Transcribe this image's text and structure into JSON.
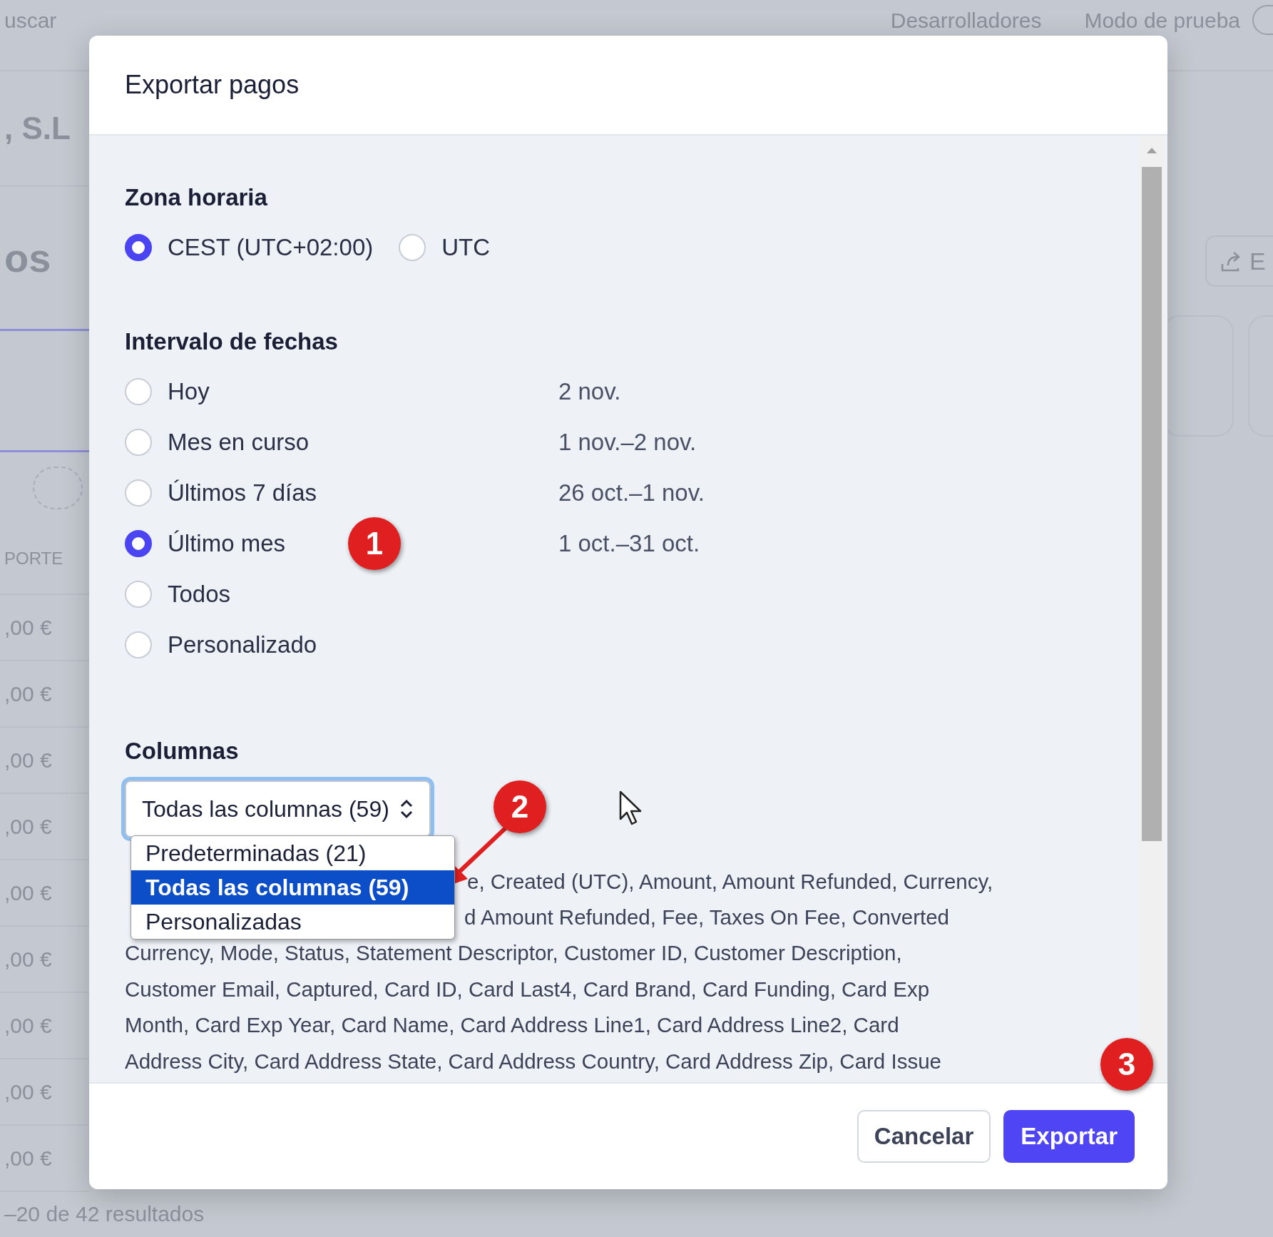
{
  "background": {
    "search": "uscar",
    "nav": [
      "Desarrolladores",
      "Modo de prueba"
    ],
    "company": ", S.L",
    "heading": "os",
    "column_header": "PORTE",
    "amounts": [
      ",00 €",
      ",00 €",
      ",00 €",
      ",00 €",
      ",00 €",
      ",00 €",
      ",00 €",
      ",00 €",
      ",00 €"
    ],
    "export_button": "E",
    "footer": "–20 de 42 resultados",
    "test_mode_toggle": {
      "on": false
    }
  },
  "dialog": {
    "title": "Exportar pagos",
    "sections": [
      {
        "title": "Zona horaria",
        "kind": "row",
        "options": [
          {
            "label": "CEST (UTC+02:00)",
            "selected": true
          },
          {
            "label": "UTC",
            "selected": false
          }
        ]
      },
      {
        "title": "Intervalo de fechas",
        "kind": "column",
        "options": [
          {
            "label": "Hoy",
            "range": "2 nov.",
            "selected": false
          },
          {
            "label": "Mes en curso",
            "range": "1 nov.–2 nov.",
            "selected": false
          },
          {
            "label": "Últimos 7 días",
            "range": "26 oct.–1 nov.",
            "selected": false
          },
          {
            "label": "Último mes",
            "range": "1 oct.–31 oct.",
            "selected": true
          },
          {
            "label": "Todos",
            "selected": false
          },
          {
            "label": "Personalizado",
            "selected": false
          }
        ]
      }
    ],
    "columns": {
      "title": "Columnas",
      "select_value": "Todas las columnas (59)",
      "dropdown": [
        {
          "label": "Predeterminadas (21)",
          "selected": false
        },
        {
          "label": "Todas las columnas (59)",
          "selected": true
        },
        {
          "label": "Personalizadas",
          "selected": false
        }
      ],
      "description_lines": [
        "e, Created (UTC), Amount, Amount Refunded, Currency,",
        "d Amount Refunded, Fee, Taxes On Fee, Converted",
        "Currency, Mode, Status, Statement Descriptor, Customer ID, Customer Description,",
        "Customer Email, Captured, Card ID, Card Last4, Card Brand, Card Funding, Card Exp",
        "Month, Card Exp Year, Card Name, Card Address Line1, Card Address Line2, Card",
        "Address City, Card Address State, Card Address Country, Card Address Zip, Card Issue"
      ]
    },
    "buttons": [
      {
        "label": "Cancelar",
        "kind": "secondary"
      },
      {
        "label": "Exportar",
        "kind": "primary"
      }
    ]
  },
  "annotations": [
    {
      "label": "1"
    },
    {
      "label": "2"
    },
    {
      "label": "3"
    }
  ]
}
